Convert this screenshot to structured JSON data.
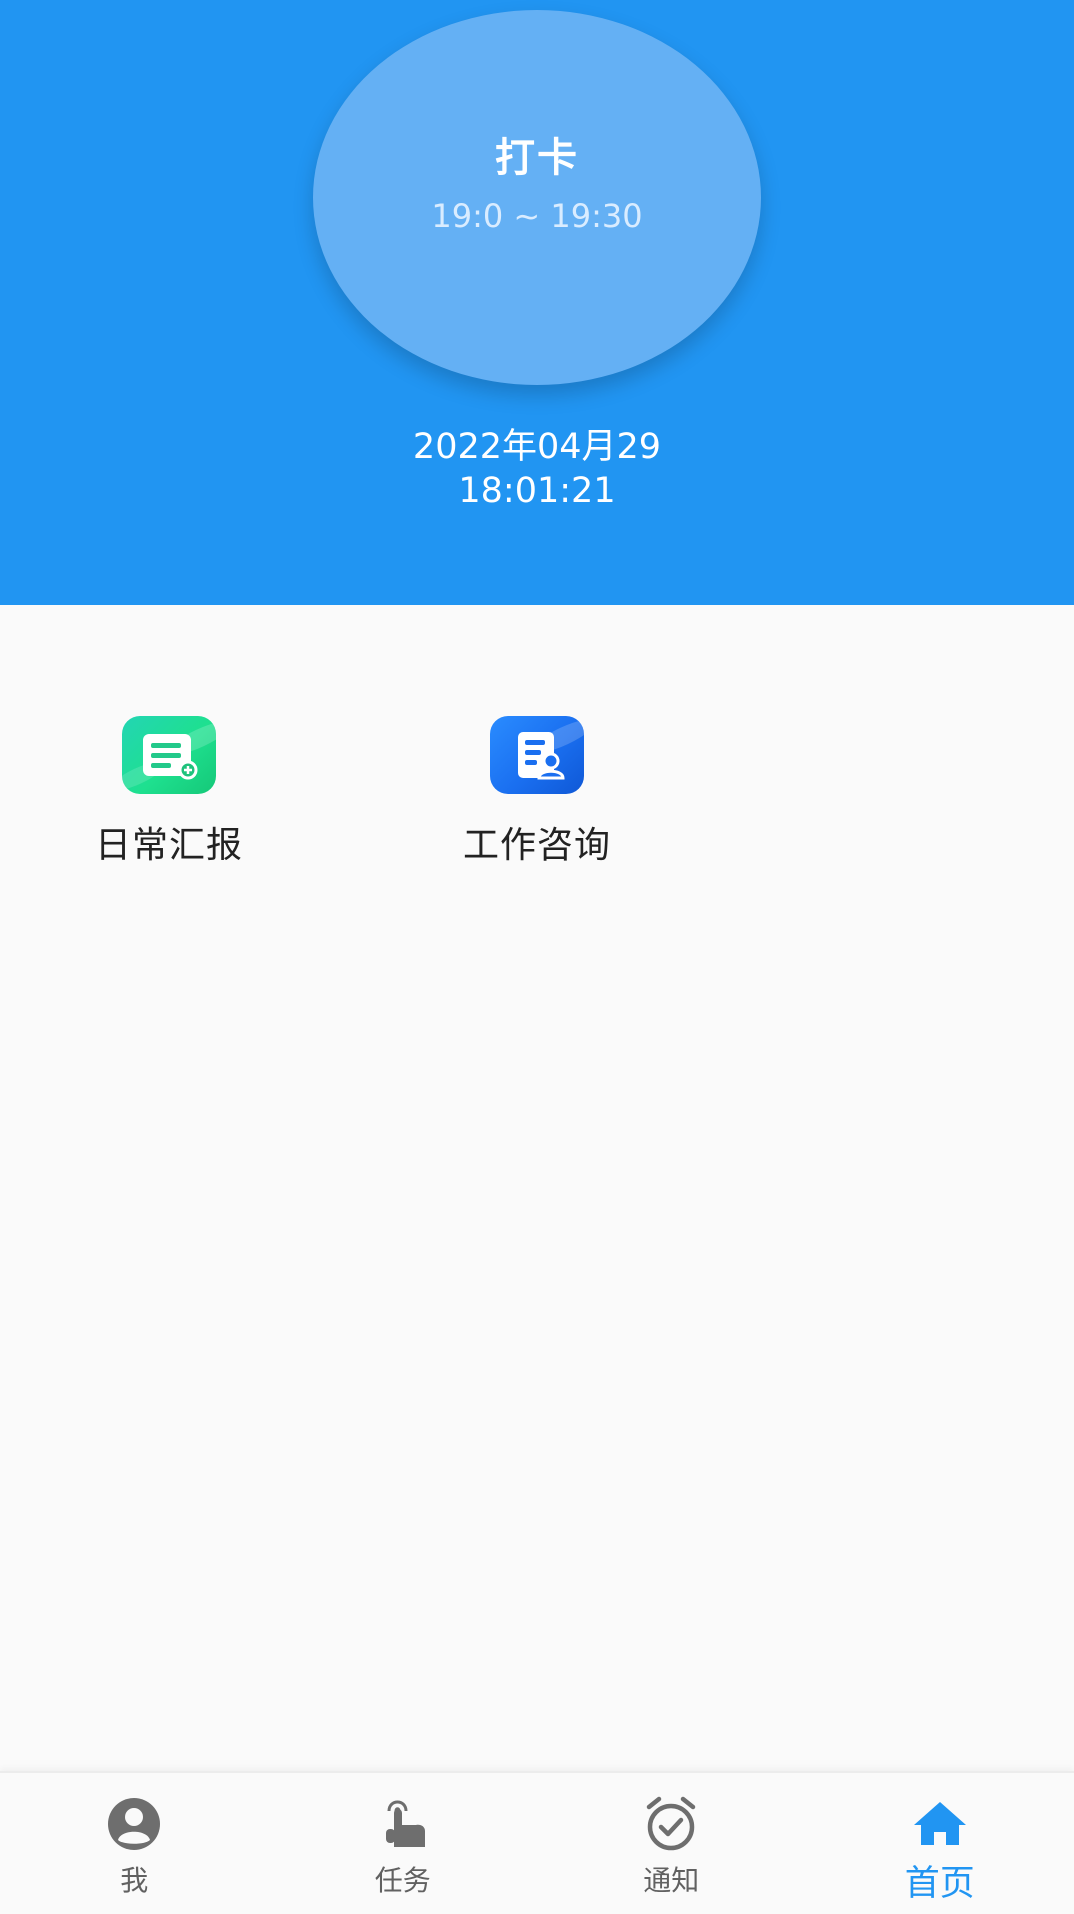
{
  "header": {
    "checkin": {
      "title": "打卡",
      "time_range": "19:0 ~ 19:30"
    },
    "date": "2022年04月29",
    "time": "18:01:21"
  },
  "features": [
    {
      "label": "日常汇报",
      "icon": "daily-report-icon"
    },
    {
      "label": "工作咨询",
      "icon": "work-consult-icon"
    }
  ],
  "bottom_nav": {
    "items": [
      {
        "label": "我",
        "icon": "person-icon",
        "active": false
      },
      {
        "label": "任务",
        "icon": "tap-hand-icon",
        "active": false
      },
      {
        "label": "通知",
        "icon": "alarm-clock-icon",
        "active": false
      },
      {
        "label": "首页",
        "icon": "home-icon",
        "active": true
      }
    ],
    "active_color": "#2195f2",
    "inactive_color": "#616161"
  },
  "colors": {
    "header_background": "#2195f2",
    "circle_background": "#64b0f4"
  }
}
